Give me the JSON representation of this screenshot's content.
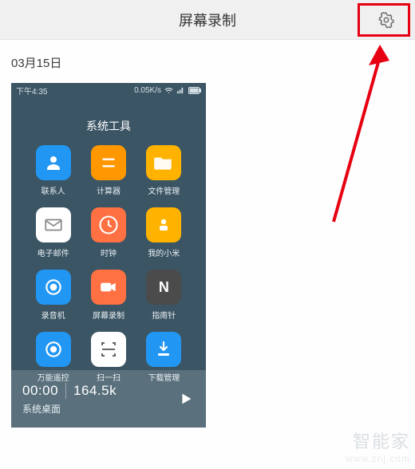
{
  "header": {
    "title": "屏幕录制"
  },
  "date": "03月15日",
  "phone": {
    "status_time": "下午4:35",
    "status_net": "0.05K/s",
    "folder_title": "系统工具",
    "apps": [
      {
        "name": "联系人",
        "icon": "contacts",
        "bg": "ic-blue"
      },
      {
        "name": "计算器",
        "icon": "calc",
        "bg": "ic-orange"
      },
      {
        "name": "文件管理",
        "icon": "folder",
        "bg": "ic-amber"
      },
      {
        "name": "电子邮件",
        "icon": "mail",
        "bg": "ic-white"
      },
      {
        "name": "时钟",
        "icon": "clock",
        "bg": "ic-orange2"
      },
      {
        "name": "我的小米",
        "icon": "mi",
        "bg": "ic-amber"
      },
      {
        "name": "录音机",
        "icon": "rec",
        "bg": "ic-blue"
      },
      {
        "name": "屏幕录制",
        "icon": "cam",
        "bg": "ic-orange2"
      },
      {
        "name": "指南针",
        "icon": "n",
        "bg": "ic-n"
      },
      {
        "name": "万能遥控",
        "icon": "remote",
        "bg": "ic-blue"
      },
      {
        "name": "扫一扫",
        "icon": "scan",
        "bg": "ic-white"
      },
      {
        "name": "下载管理",
        "icon": "download",
        "bg": "ic-blue"
      }
    ],
    "info": {
      "time": "00:00",
      "size": "164.5k",
      "name": "系统桌面"
    }
  },
  "watermark": {
    "line1": "智能家",
    "line2": "www.znj.com"
  },
  "colors": {
    "highlight": "#e60012"
  }
}
